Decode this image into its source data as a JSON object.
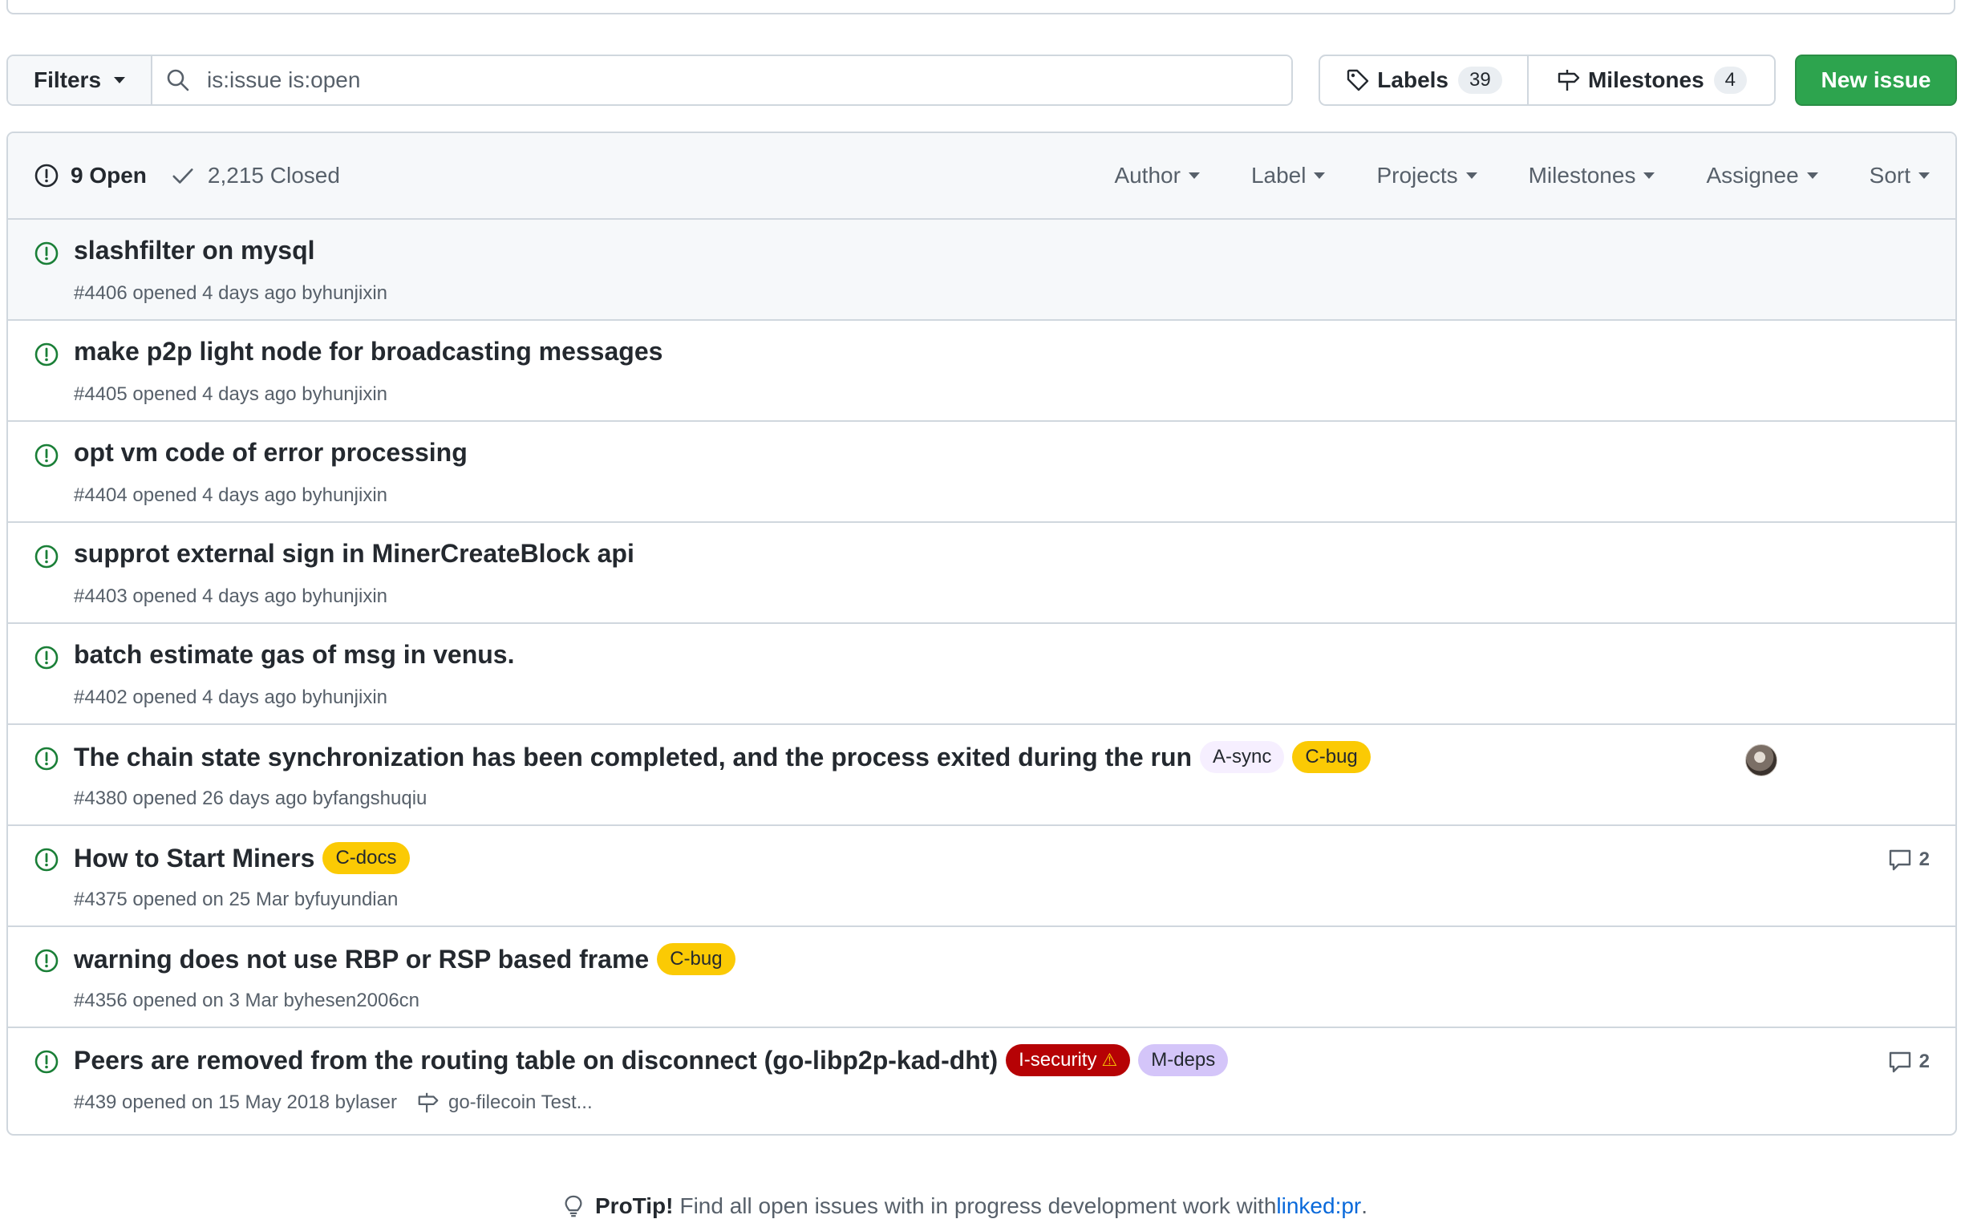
{
  "toolbar": {
    "filters_label": "Filters",
    "search_value": "is:issue is:open",
    "labels_label": "Labels",
    "labels_count": "39",
    "milestones_label": "Milestones",
    "milestones_count": "4",
    "new_issue_label": "New issue"
  },
  "header": {
    "open_label": "9 Open",
    "closed_label": "2,215 Closed",
    "filters": [
      "Author",
      "Label",
      "Projects",
      "Milestones",
      "Assignee",
      "Sort"
    ]
  },
  "issues": [
    {
      "title": "slashfilter on mysql",
      "meta": "#4406 opened 4 days ago by ",
      "author": "hunjixin"
    },
    {
      "title": "make p2p light node for broadcasting messages",
      "meta": "#4405 opened 4 days ago by ",
      "author": "hunjixin"
    },
    {
      "title": "opt vm code of error processing",
      "meta": "#4404 opened 4 days ago by ",
      "author": "hunjixin"
    },
    {
      "title": "supprot external sign in MinerCreateBlock api",
      "meta": "#4403 opened 4 days ago by ",
      "author": "hunjixin"
    },
    {
      "title": "batch estimate gas of msg in venus.",
      "meta": "#4402 opened 4 days ago by ",
      "author": "hunjixin"
    },
    {
      "title": "The chain state synchronization has been completed, and the process exited during the run",
      "meta": "#4380 opened 26 days ago by ",
      "author": "fangshuqiu",
      "labels": [
        "A-sync",
        "C-bug"
      ]
    },
    {
      "title": "How to Start Miners",
      "meta": "#4375 opened on 25 Mar by ",
      "author": "fuyundian",
      "labels": [
        "C-docs"
      ],
      "comments": "2"
    },
    {
      "title": "warning does not use RBP or RSP based frame",
      "meta": "#4356 opened on 3 Mar by ",
      "author": "hesen2006cn",
      "labels": [
        "C-bug"
      ]
    },
    {
      "title": "Peers are removed from the routing table on disconnect (go-libp2p-kad-dht)",
      "meta": "#439 opened on 15 May 2018 by ",
      "author": "laser",
      "labels": [
        "I-security",
        "M-deps"
      ],
      "milestone": "go-filecoin Test...",
      "comments": "2"
    }
  ],
  "protip": {
    "lead": "ProTip!",
    "text": "Find all open issues with in progress development work with ",
    "link": "linked:pr",
    "tail": "."
  },
  "colors": {
    "open_green": "#1a7f37",
    "new_issue_green": "#2da44e",
    "label_yellow": "#fbca04",
    "label_security": "#b60205",
    "label_deps": "#d4c5f9",
    "label_sync": "#f6efff",
    "link_blue": "#0969da"
  },
  "icons": {
    "search": "search-icon",
    "tag": "tag-icon",
    "milestone": "milestone-icon",
    "issue_open": "issue-opened-icon",
    "check": "check-icon",
    "comment": "comment-icon",
    "warning": "warning-icon",
    "light_bulb": "light-bulb-icon"
  }
}
